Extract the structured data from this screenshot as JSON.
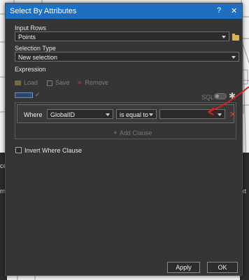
{
  "dialog": {
    "title": "Select By Attributes",
    "help_glyph": "?",
    "close_glyph": "✕"
  },
  "input_rows": {
    "label": "Input Rows",
    "value": "Points"
  },
  "selection_type": {
    "label": "Selection Type",
    "value": "New selection"
  },
  "expression": {
    "label": "Expression",
    "load_label": "Load",
    "save_label": "Save",
    "remove_label": "Remove",
    "sql_label": "SQL"
  },
  "clause": {
    "where_label": "Where",
    "field": "GlobalID",
    "operator": "is equal to",
    "value": "",
    "add_clause_label": "Add Clause"
  },
  "invert_label": "Invert Where Clause",
  "buttons": {
    "apply": "Apply",
    "ok": "OK"
  },
  "background": {
    "left_text_1": "cel",
    "left_text_2": "rn",
    "right_text": "xt"
  },
  "colors": {
    "titlebar": "#1e6fc0",
    "dialog_bg": "#353535",
    "annotation_arrow": "#d8202a"
  },
  "icons": [
    "folder-open-icon",
    "load-icon",
    "save-icon",
    "remove-x-icon",
    "sql-toggle",
    "gear-icon",
    "add-icon",
    "delete-clause-icon"
  ]
}
